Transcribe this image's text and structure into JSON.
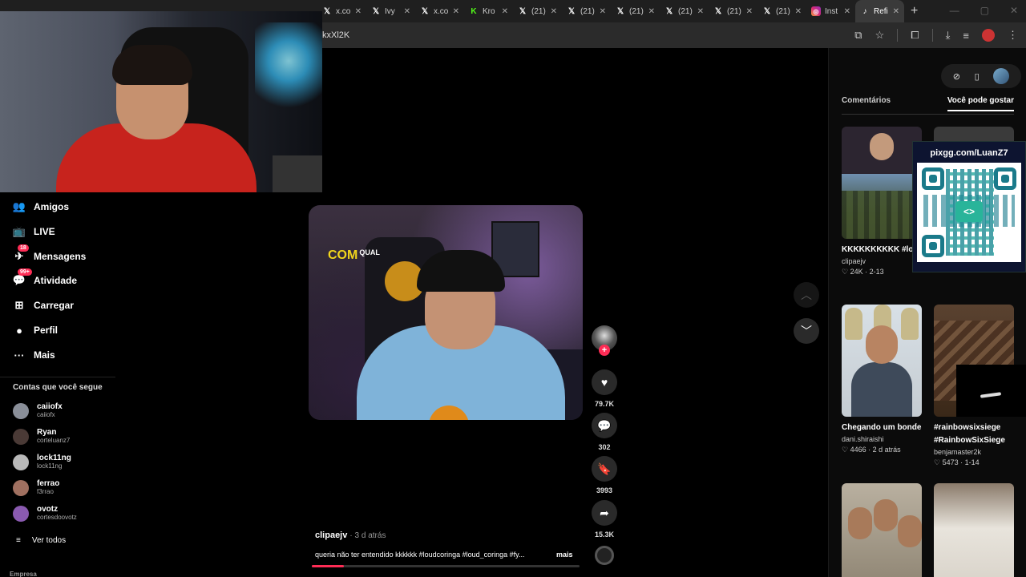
{
  "browser": {
    "tabs": [
      {
        "icon": "x-logo-icon",
        "glyph": "𝕏",
        "label": "x.co",
        "class": "xlogo"
      },
      {
        "icon": "x-logo-icon",
        "glyph": "𝕏",
        "label": "Ivy",
        "class": "xlogo"
      },
      {
        "icon": "x-logo-icon",
        "glyph": "𝕏",
        "label": "x.co",
        "class": "xlogo"
      },
      {
        "icon": "kick-logo-icon",
        "glyph": "K",
        "label": "Kro",
        "class": "kick"
      },
      {
        "icon": "x-logo-icon",
        "glyph": "𝕏",
        "label": "(21)",
        "class": "xlogo"
      },
      {
        "icon": "x-logo-icon",
        "glyph": "𝕏",
        "label": "(21)",
        "class": "xlogo"
      },
      {
        "icon": "x-logo-icon",
        "glyph": "𝕏",
        "label": "(21)",
        "class": "xlogo"
      },
      {
        "icon": "x-logo-icon",
        "glyph": "𝕏",
        "label": "(21)",
        "class": "xlogo"
      },
      {
        "icon": "x-logo-icon",
        "glyph": "𝕏",
        "label": "(21)",
        "class": "xlogo"
      },
      {
        "icon": "x-logo-icon",
        "glyph": "𝕏",
        "label": "(21)",
        "class": "xlogo"
      },
      {
        "icon": "instagram-logo-icon",
        "glyph": "◎",
        "label": "Inst",
        "class": "insta"
      },
      {
        "icon": "tiktok-logo-icon",
        "glyph": "♪",
        "label": "Refi",
        "class": "tiktok",
        "active": true
      }
    ],
    "new_tab": "+",
    "url_fragment": "kxXl2K"
  },
  "nav": {
    "items": [
      {
        "name": "nav-friends",
        "icon": "friends-icon",
        "glyph": "👥",
        "label": "Amigos"
      },
      {
        "name": "nav-live",
        "icon": "live-icon",
        "glyph": "📺",
        "label": "LIVE"
      },
      {
        "name": "nav-messages",
        "icon": "messages-icon",
        "glyph": "✈",
        "label": "Mensagens",
        "badge": "18"
      },
      {
        "name": "nav-activity",
        "icon": "activity-icon",
        "glyph": "💬",
        "label": "Atividade",
        "badge": "99+"
      },
      {
        "name": "nav-upload",
        "icon": "upload-icon",
        "glyph": "⊞",
        "label": "Carregar"
      },
      {
        "name": "nav-profile",
        "icon": "profile-avatar-icon",
        "glyph": "●",
        "label": "Perfil"
      },
      {
        "name": "nav-more",
        "icon": "more-icon",
        "glyph": "···",
        "label": "Mais"
      }
    ],
    "following_title": "Contas que você segue",
    "following": [
      {
        "name": "caiiofx",
        "handle": "caiiofx",
        "color": "#8a8f99"
      },
      {
        "name": "Ryan",
        "handle": "corteluanz7",
        "color": "#4a3a36"
      },
      {
        "name": "lock11ng",
        "handle": "lock11ng",
        "color": "#b9b9b9"
      },
      {
        "name": "ferrao",
        "handle": "f3rrao",
        "color": "#a07060"
      },
      {
        "name": "ovotz",
        "handle": "cortesdoovotz",
        "color": "#8a5ab0"
      }
    ],
    "see_all": "Ver todos",
    "company": "Empresa"
  },
  "video": {
    "overlay_text": "COM",
    "overlay_small": "QUAL",
    "author": "clipaejv",
    "time": "· 3 d atrás",
    "description": "queria não ter entendido kkkkkk #loudcoringa #loud_coringa #fy...",
    "more": "mais",
    "progress": 0.12,
    "likes": "79.7K",
    "comments": "302",
    "saves": "3993",
    "shares": "15.3K"
  },
  "right": {
    "tabs": {
      "comments": "Comentários",
      "suggested": "Você pode gostar"
    },
    "cards": [
      {
        "title": "KKKKKKKKKK #loudcoringa...",
        "author": "clipaejv",
        "likes": "24K",
        "date": "2-13"
      },
      {
        "title": "",
        "author": "",
        "likes": "",
        "date": ""
      },
      {
        "title": "Chegando um bonde forte pra...",
        "author": "dani.shiraishi",
        "likes": "4466",
        "date": "2 d atrás"
      },
      {
        "title": "#rainbowsixsiege #RainbowSixSiege",
        "author": "benjamaster2k",
        "likes": "5473",
        "date": "1-14"
      },
      {
        "title": "",
        "author": "",
        "likes": "",
        "date": ""
      },
      {
        "title": "",
        "author": "",
        "likes": "",
        "date": ""
      }
    ],
    "qr_title": "pixgg.com/LuanZ7"
  }
}
